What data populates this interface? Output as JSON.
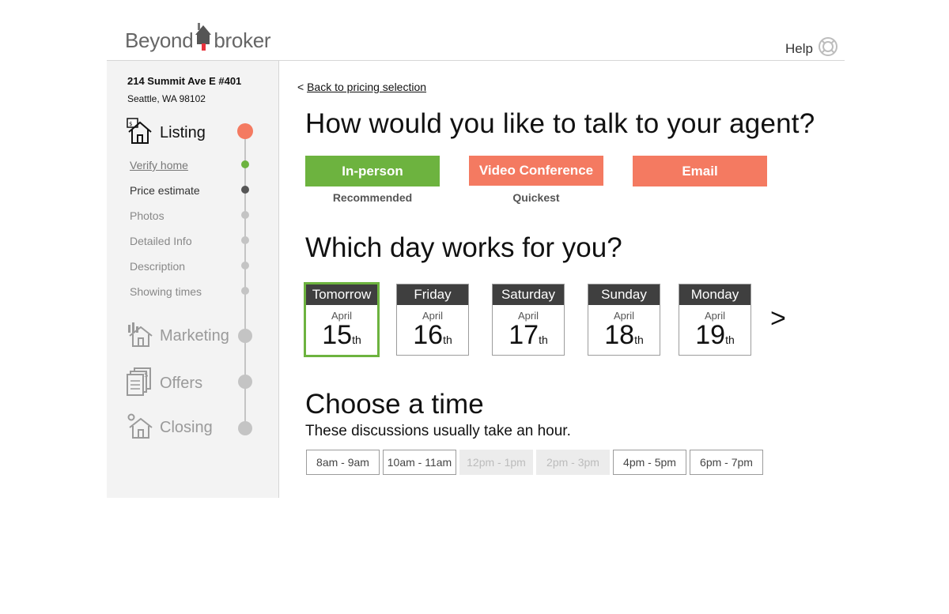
{
  "brand": {
    "word1": "Beyond",
    "word2": "broker",
    "accent_color": "#e8323c"
  },
  "header": {
    "help_label": "Help",
    "help_icon": "lifebuoy-icon"
  },
  "sidebar": {
    "address_line1": "214 Summit Ave E #401",
    "address_line2": "Seattle, WA 98102",
    "sections": [
      {
        "label": "Listing",
        "icon": "house-icon",
        "state": "active",
        "dot_color": "#f47a61"
      },
      {
        "label": "Marketing",
        "icon": "house-chart-icon",
        "state": "inactive",
        "dot_color": "#c4c4c4"
      },
      {
        "label": "Offers",
        "icon": "documents-dollar-icon",
        "state": "inactive",
        "dot_color": "#c4c4c4"
      },
      {
        "label": "Closing",
        "icon": "house-gear-icon",
        "state": "inactive",
        "dot_color": "#c4c4c4"
      }
    ],
    "listing_steps": [
      {
        "label": "Verify home",
        "state": "done",
        "dot_color": "#6db33f"
      },
      {
        "label": "Price estimate",
        "state": "current",
        "dot_color": "#555555"
      },
      {
        "label": "Photos",
        "state": "pending",
        "dot_color": "#c4c4c4"
      },
      {
        "label": "Detailed Info",
        "state": "pending",
        "dot_color": "#c4c4c4"
      },
      {
        "label": "Description",
        "state": "pending",
        "dot_color": "#c4c4c4"
      },
      {
        "label": "Showing times",
        "state": "pending",
        "dot_color": "#c4c4c4"
      }
    ]
  },
  "main": {
    "back_prefix": "<",
    "back_label": "Back to pricing selection",
    "agent_heading": "How would you like to talk to your agent?",
    "methods": [
      {
        "label": "In-person",
        "note": "Recommended",
        "color": "#6db33f"
      },
      {
        "label": "Video Conference",
        "note": "Quickest",
        "color": "#f47a61"
      },
      {
        "label": "Email",
        "note": "",
        "color": "#f47a61"
      }
    ],
    "day_heading": "Which day works for you?",
    "days": [
      {
        "name": "Tomorrow",
        "month": "April",
        "day": "15",
        "suffix": "th",
        "selected": true
      },
      {
        "name": "Friday",
        "month": "April",
        "day": "16",
        "suffix": "th",
        "selected": false
      },
      {
        "name": "Saturday",
        "month": "April",
        "day": "17",
        "suffix": "th",
        "selected": false
      },
      {
        "name": "Sunday",
        "month": "April",
        "day": "18",
        "suffix": "th",
        "selected": false
      },
      {
        "name": "Monday",
        "month": "April",
        "day": "19",
        "suffix": "th",
        "selected": false
      }
    ],
    "next_days_label": ">",
    "time_heading": "Choose a time",
    "time_subheading": "These discussions usually take an hour.",
    "slots": [
      {
        "label": "8am - 9am",
        "available": true
      },
      {
        "label": "10am - 11am",
        "available": true
      },
      {
        "label": "12pm - 1pm",
        "available": false
      },
      {
        "label": "2pm - 3pm",
        "available": false
      },
      {
        "label": "4pm - 5pm",
        "available": true
      },
      {
        "label": "6pm - 7pm",
        "available": true
      }
    ],
    "selected_color": "#6db33f"
  }
}
